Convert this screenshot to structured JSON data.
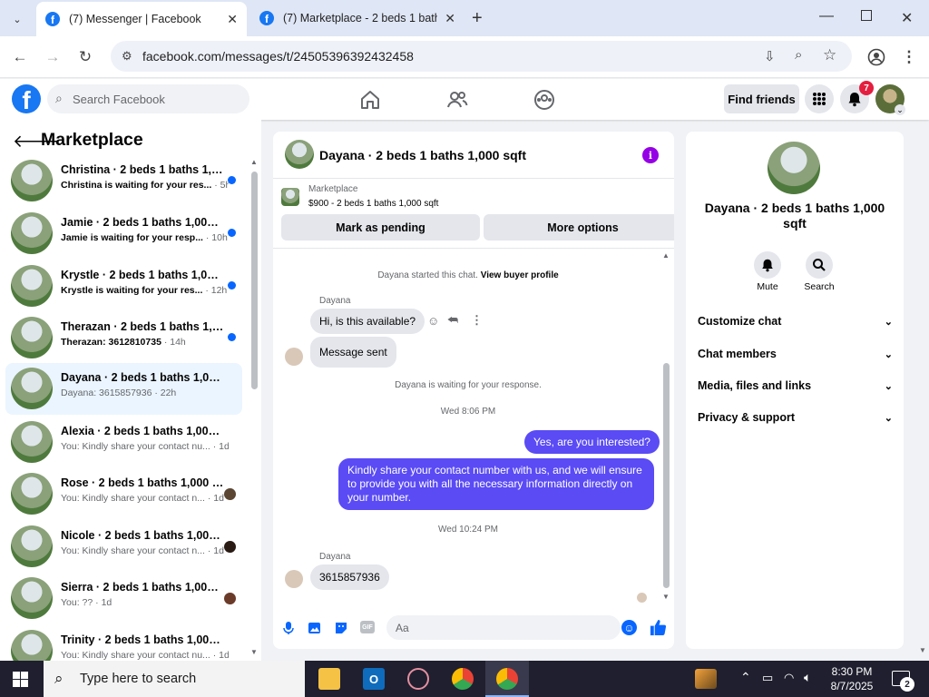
{
  "browser": {
    "tabs": [
      {
        "title": "(7) Messenger | Facebook"
      },
      {
        "title": "(7) Marketplace - 2 beds 1 bath"
      }
    ],
    "url": "facebook.com/messages/t/24505396392432458"
  },
  "header": {
    "search_placeholder": "Search Facebook",
    "find_friends": "Find friends",
    "notification_count": "7"
  },
  "sidebar": {
    "title": "Marketplace",
    "conversations": [
      {
        "name": "Christina · 2 beds 1 baths 1,00...",
        "preview": "Christina is waiting for your res...",
        "time": "· 5h",
        "unread": true
      },
      {
        "name": "Jamie · 2 beds 1 baths 1,000 sqft",
        "preview": "Jamie is waiting for your resp...",
        "time": "· 10h",
        "unread": true
      },
      {
        "name": "Krystle · 2 beds 1 baths 1,000 s...",
        "preview": "Krystle is waiting for your res...",
        "time": "· 12h",
        "unread": true
      },
      {
        "name": "Therazan · 2 beds 1 baths 1,00...",
        "preview": "Therazan: 3612810735",
        "time": "· 14h",
        "unread": true
      },
      {
        "name": "Dayana · 2 beds 1 baths 1,000 sqft",
        "preview": "Dayana: 3615857936",
        "time": "· 22h",
        "unread": false
      },
      {
        "name": "Alexia · 2 beds 1 baths 1,000 sqft",
        "preview": "You: Kindly share your contact nu...",
        "time": "· 1d",
        "unread": false
      },
      {
        "name": "Rose · 2 beds 1 baths 1,000 sqft",
        "preview": "You: Kindly share your contact n...",
        "time": "· 1d",
        "unread": false
      },
      {
        "name": "Nicole · 2 beds 1 baths 1,000 s...",
        "preview": "You: Kindly share your contact n...",
        "time": "· 1d",
        "unread": false
      },
      {
        "name": "Sierra · 2 beds 1 baths 1,000 s...",
        "preview": "You: ??",
        "time": "· 1d",
        "unread": false
      },
      {
        "name": "Trinity · 2 beds 1 baths 1,000 sqft",
        "preview": "You: Kindly share your contact nu...",
        "time": "· 1d",
        "unread": false
      }
    ]
  },
  "chat": {
    "title": "Dayana · 2 beds 1 baths 1,000 sqft",
    "listing_label": "Marketplace",
    "listing_price": "$900 - 2 beds 1 baths 1,000 sqft",
    "mark_pending": "Mark as pending",
    "more_options": "More options",
    "started_text": "Dayana started this chat.",
    "view_profile": "View buyer profile",
    "sender1": "Dayana",
    "msg1": "Hi, is this available?",
    "msg2": "Message sent",
    "waiting": "Dayana is waiting for your response.",
    "time1": "Wed 8:06 PM",
    "out1": "Yes, are you interested?",
    "out2": "Kindly share your contact number with us, and we will ensure to provide you with all the necessary information directly on your number.",
    "time2": "Wed 10:24 PM",
    "sender2": "Dayana",
    "msg3": "3615857936",
    "composer_placeholder": "Aa"
  },
  "details": {
    "name": "Dayana · 2 beds 1 baths 1,000 sqft",
    "mute": "Mute",
    "search": "Search",
    "sections": [
      "Customize chat",
      "Chat members",
      "Media, files and links",
      "Privacy & support"
    ]
  },
  "taskbar": {
    "search_placeholder": "Type here to search",
    "time": "8:30 PM",
    "date": "8/7/2025",
    "notifications": "2"
  }
}
